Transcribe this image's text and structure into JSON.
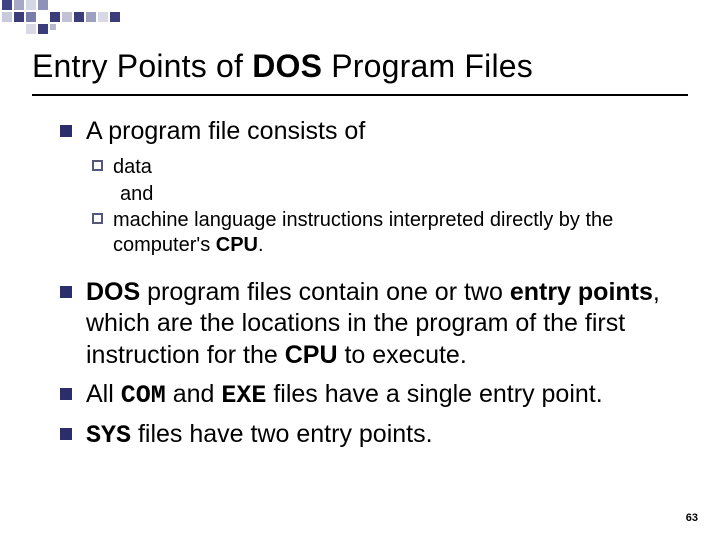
{
  "deco": {
    "colors": [
      "#3a3d7a",
      "#4a4d88",
      "#6d70a3",
      "#8f92b8",
      "#b6b8d0",
      "#d9d9e6"
    ]
  },
  "title": {
    "pre": "Entry Points of ",
    "dos": "DOS",
    "post": " Program Files"
  },
  "bullet_intro": "A program file consists of",
  "sub_data": "data",
  "and": "and",
  "sub_machine_pre": "machine language instructions interpreted directly by the computer's ",
  "sub_machine_cpu": "CPU",
  "sub_machine_post": ".",
  "b2": {
    "dos": "DOS",
    "mid1": " program files contain one or two ",
    "entry": "entry points",
    "mid2": ", which are the locations in the program of the first instruction for the ",
    "cpu": "CPU",
    "post": " to execute."
  },
  "b3": {
    "pre": "All ",
    "com": "COM",
    "and": " and ",
    "exe": "EXE",
    "post": " files have a single entry point."
  },
  "b4": {
    "sys": "SYS",
    "post": " files have two entry points."
  },
  "pagenum": "63"
}
